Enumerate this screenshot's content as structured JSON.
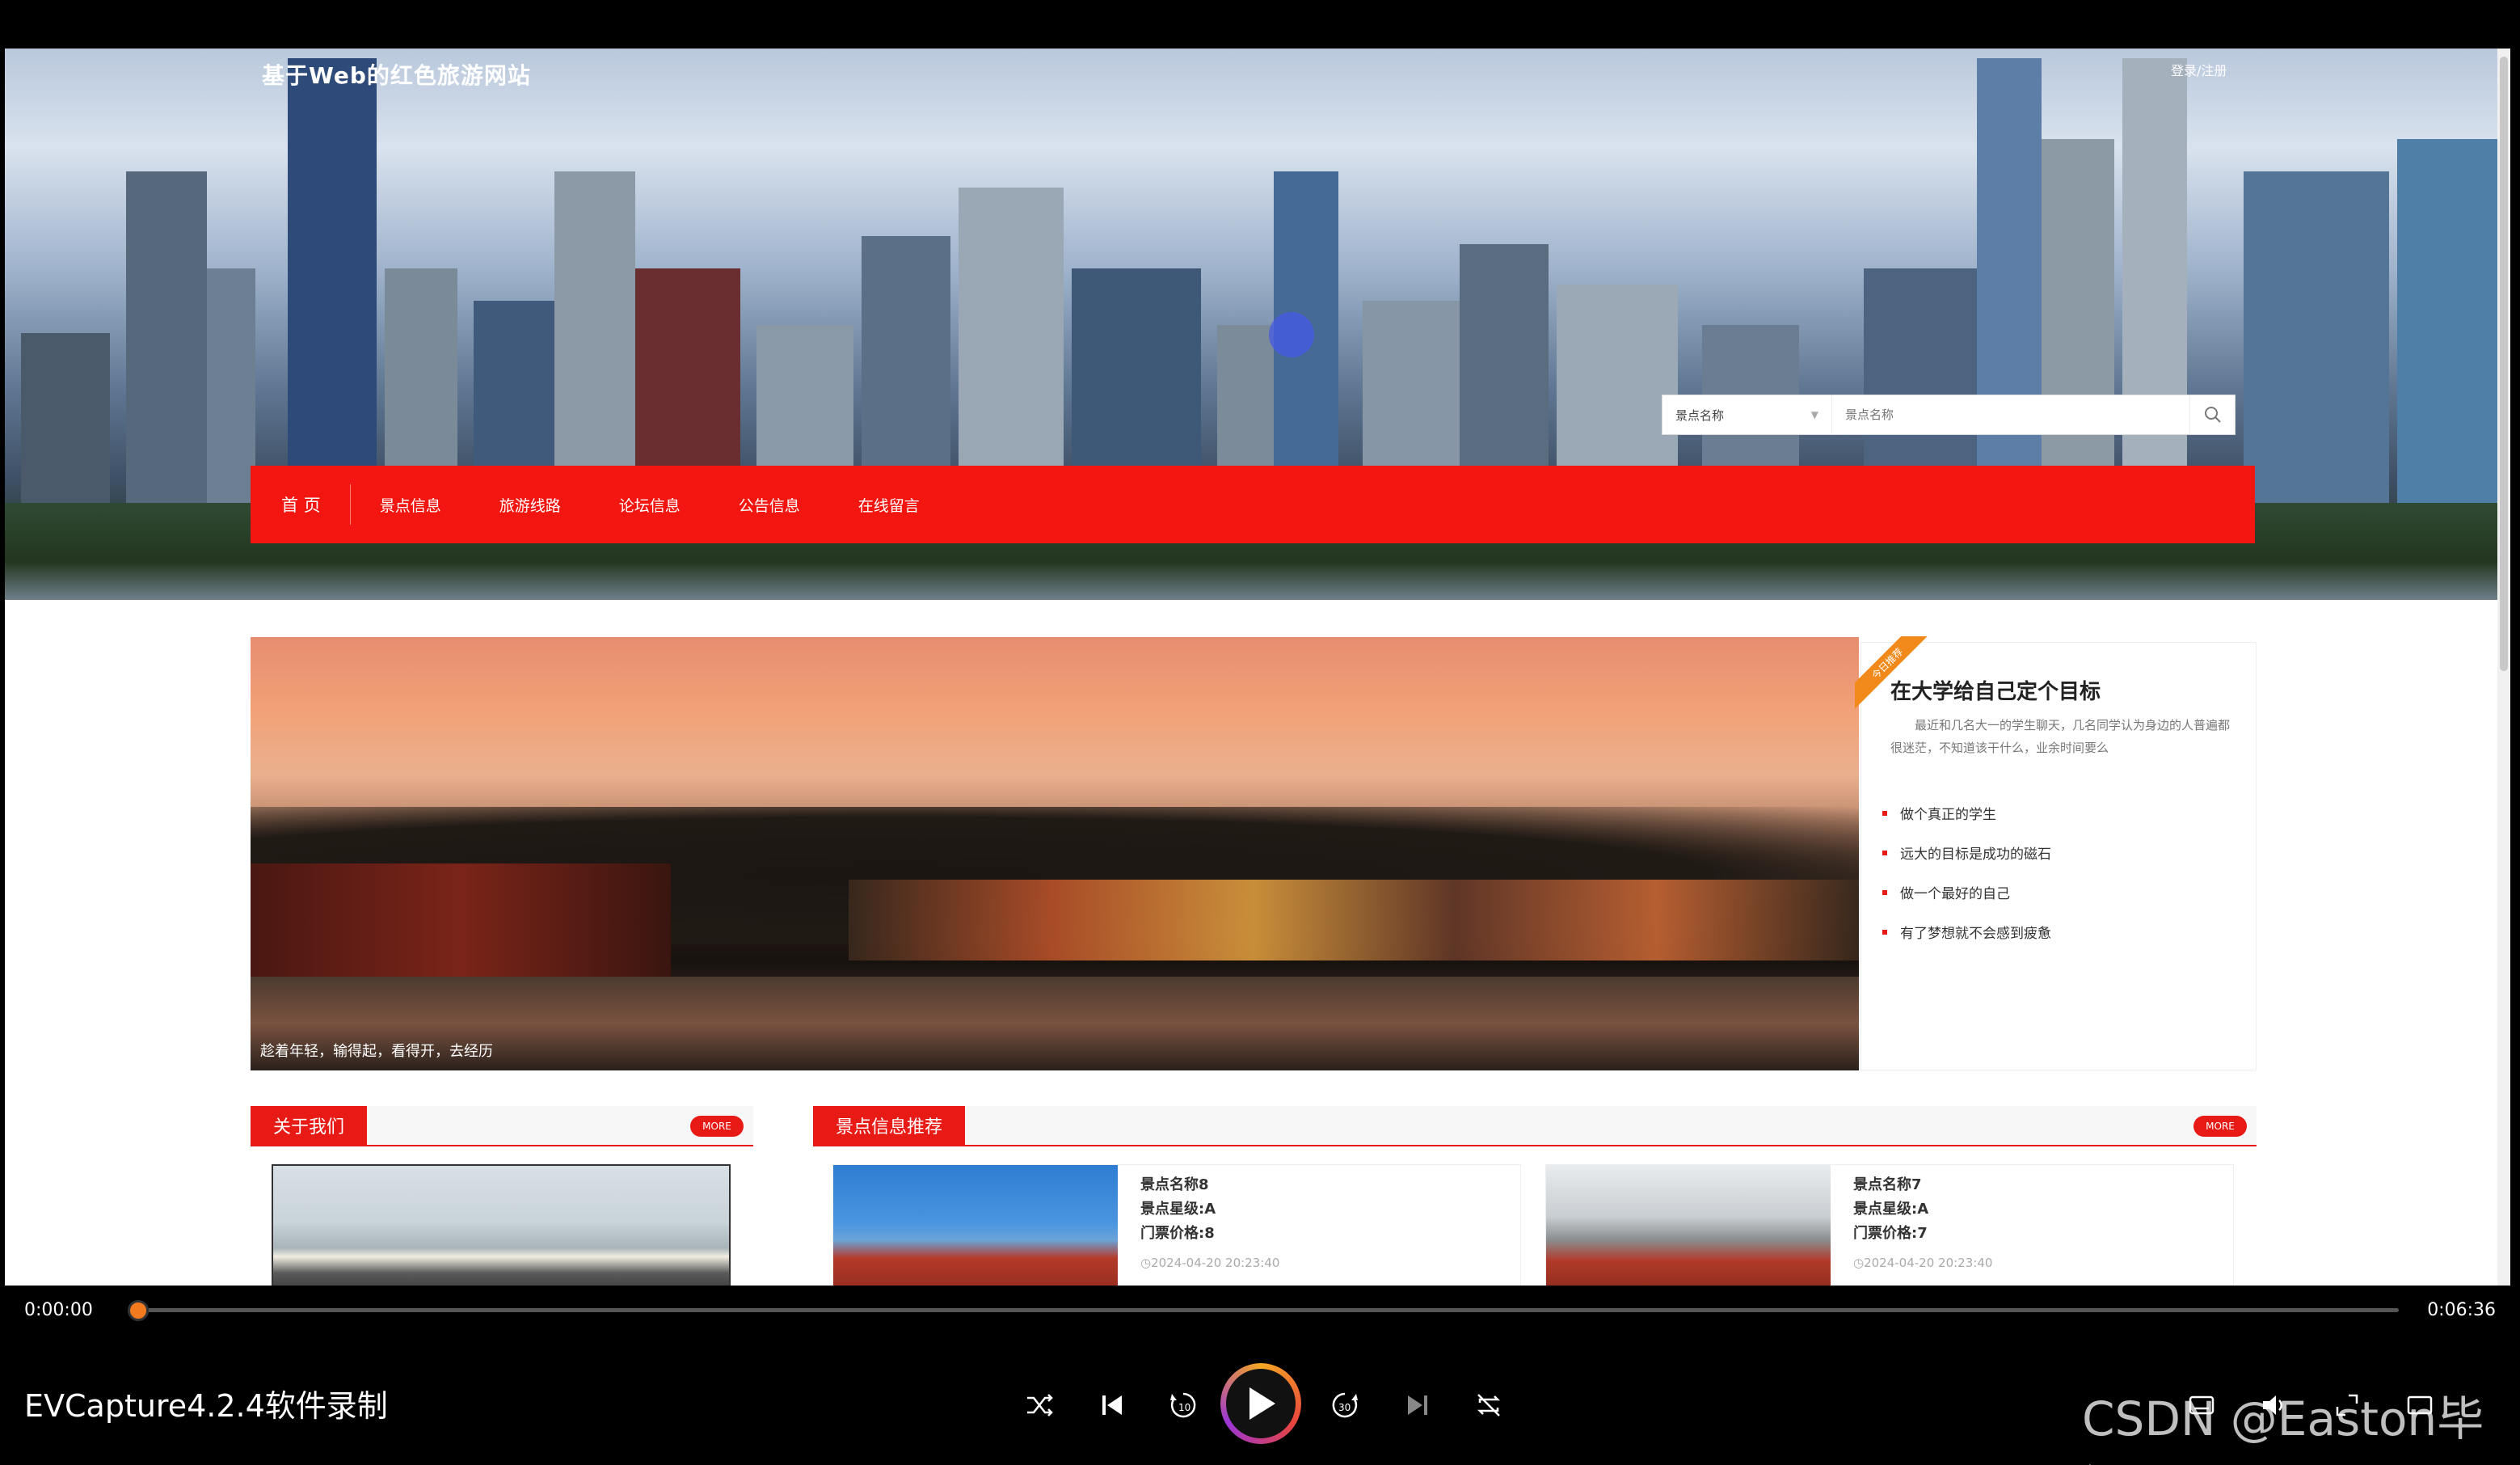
{
  "site": {
    "title": "基于Web的红色旅游网站",
    "login_label": "登录/注册"
  },
  "search": {
    "type_label": "景点名称",
    "placeholder": "景点名称"
  },
  "nav": {
    "items": [
      {
        "label": "首 页"
      },
      {
        "label": "景点信息"
      },
      {
        "label": "旅游线路"
      },
      {
        "label": "论坛信息"
      },
      {
        "label": "公告信息"
      },
      {
        "label": "在线留言"
      }
    ]
  },
  "slider": {
    "caption": "趁着年轻，输得起，看得开，去经历"
  },
  "side_card": {
    "ribbon": "今日推荐",
    "title": "在大学给自己定个目标",
    "desc": "最近和几名大一的学生聊天，几名同学认为身边的人普遍都很迷茫，不知道该干什么，业余时间要么",
    "items": [
      {
        "label": "做个真正的学生"
      },
      {
        "label": "远大的目标是成功的磁石"
      },
      {
        "label": "做一个最好的自己"
      },
      {
        "label": "有了梦想就不会感到疲惫"
      }
    ]
  },
  "about": {
    "title": "关于我们",
    "more": "MORE"
  },
  "spots": {
    "title": "景点信息推荐",
    "more": "MORE",
    "cards": [
      {
        "name": "景点名称8",
        "star": "景点星级:A",
        "price": "门票价格:8",
        "time": "2024-04-20 20:23:40"
      },
      {
        "name": "景点名称7",
        "star": "景点星级:A",
        "price": "门票价格:7",
        "time": "2024-04-20 20:23:40"
      }
    ]
  },
  "player": {
    "current_time": "0:00:00",
    "total_time": "0:06:36",
    "progress": 0.0,
    "recorder_label": "EVCapture4.2.4软件录制",
    "watermark": "CSDN @Easton毕设"
  },
  "colors": {
    "nav_red": "#f3150f",
    "accent_red": "#e81a16",
    "ribbon_orange": "#f28a1b",
    "player_thumb": "#f47a20"
  }
}
